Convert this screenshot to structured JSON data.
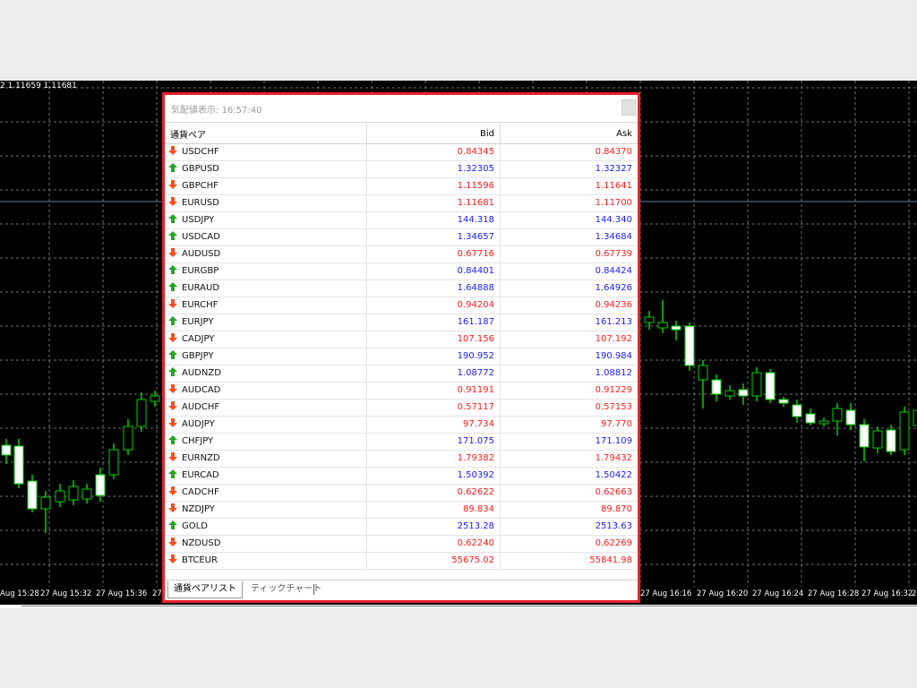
{
  "chart": {
    "quote": "2 1.11659 1.11681",
    "time_labels": [
      "Aug 15:28",
      "27 Aug 15:32",
      "27 Aug 15:36",
      "27",
      "27 Aug 16:16",
      "27 Aug 16:20",
      "27 Aug 16:24",
      "27 Aug 16:28",
      "27 Aug 16:32",
      "2"
    ],
    "colors": {
      "up": "#00d000",
      "down": "#ffffff",
      "grid": "#6f6f6f",
      "bg": "#000000"
    }
  },
  "market_watch": {
    "title": "気配値表示: 16:57:40",
    "columns": {
      "symbol": "通貨ペア",
      "bid": "Bid",
      "ask": "Ask"
    },
    "colors": {
      "up": "#1a1aff",
      "down": "#ff1a1a",
      "arrow_up": "#25a425",
      "arrow_down": "#ff4d1f"
    },
    "rows": [
      {
        "symbol": "USDCHF",
        "bid": "0.84345",
        "ask": "0.84370",
        "dir": "down"
      },
      {
        "symbol": "GBPUSD",
        "bid": "1.32305",
        "ask": "1.32327",
        "dir": "up"
      },
      {
        "symbol": "GBPCHF",
        "bid": "1.11596",
        "ask": "1.11641",
        "dir": "down"
      },
      {
        "symbol": "EURUSD",
        "bid": "1.11681",
        "ask": "1.11700",
        "dir": "down"
      },
      {
        "symbol": "USDJPY",
        "bid": "144.318",
        "ask": "144.340",
        "dir": "up"
      },
      {
        "symbol": "USDCAD",
        "bid": "1.34657",
        "ask": "1.34684",
        "dir": "up"
      },
      {
        "symbol": "AUDUSD",
        "bid": "0.67716",
        "ask": "0.67739",
        "dir": "down"
      },
      {
        "symbol": "EURGBP",
        "bid": "0.84401",
        "ask": "0.84424",
        "dir": "up"
      },
      {
        "symbol": "EURAUD",
        "bid": "1.64888",
        "ask": "1.64926",
        "dir": "up"
      },
      {
        "symbol": "EURCHF",
        "bid": "0.94204",
        "ask": "0.94236",
        "dir": "down"
      },
      {
        "symbol": "EURJPY",
        "bid": "161.187",
        "ask": "161.213",
        "dir": "up"
      },
      {
        "symbol": "CADJPY",
        "bid": "107.156",
        "ask": "107.192",
        "dir": "down"
      },
      {
        "symbol": "GBPJPY",
        "bid": "190.952",
        "ask": "190.984",
        "dir": "up"
      },
      {
        "symbol": "AUDNZD",
        "bid": "1.08772",
        "ask": "1.08812",
        "dir": "up"
      },
      {
        "symbol": "AUDCAD",
        "bid": "0.91191",
        "ask": "0.91229",
        "dir": "down"
      },
      {
        "symbol": "AUDCHF",
        "bid": "0.57117",
        "ask": "0.57153",
        "dir": "down"
      },
      {
        "symbol": "AUDJPY",
        "bid": "97.734",
        "ask": "97.770",
        "dir": "down"
      },
      {
        "symbol": "CHFJPY",
        "bid": "171.075",
        "ask": "171.109",
        "dir": "up"
      },
      {
        "symbol": "EURNZD",
        "bid": "1.79382",
        "ask": "1.79432",
        "dir": "down"
      },
      {
        "symbol": "EURCAD",
        "bid": "1.50392",
        "ask": "1.50422",
        "dir": "up"
      },
      {
        "symbol": "CADCHF",
        "bid": "0.62622",
        "ask": "0.62663",
        "dir": "down"
      },
      {
        "symbol": "NZDJPY",
        "bid": "89.834",
        "ask": "89.870",
        "dir": "down"
      },
      {
        "symbol": "GOLD",
        "bid": "2513.28",
        "ask": "2513.63",
        "dir": "up"
      },
      {
        "symbol": "NZDUSD",
        "bid": "0.62240",
        "ask": "0.62269",
        "dir": "down"
      },
      {
        "symbol": "BTCEUR",
        "bid": "55675.02",
        "ask": "55841.98",
        "dir": "down"
      }
    ],
    "tabs": [
      {
        "label": "通貨ペアリスト",
        "active": true
      },
      {
        "label": "ティックチャート",
        "active": false
      }
    ]
  }
}
